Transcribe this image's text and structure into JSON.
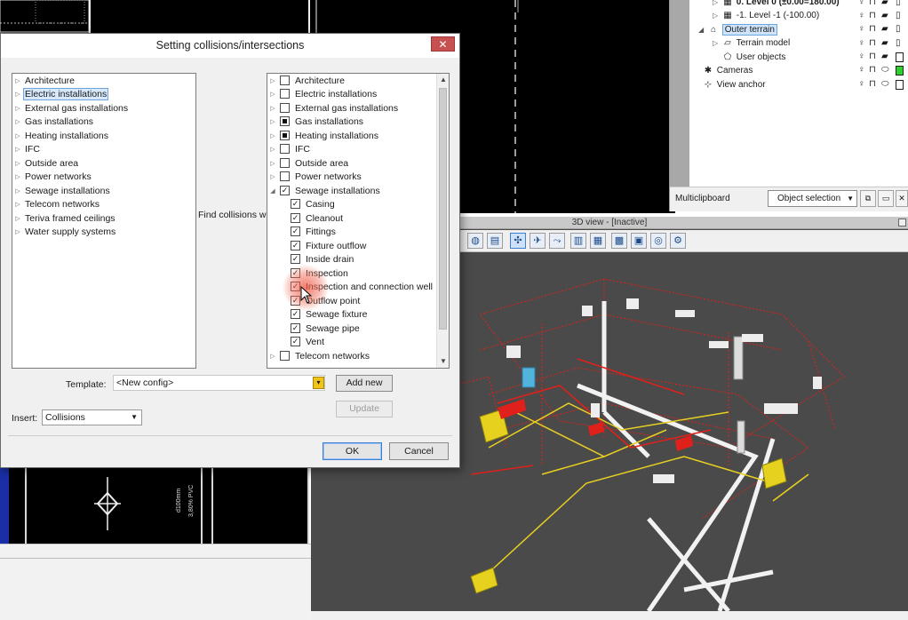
{
  "background": {
    "tree": {
      "items": [
        {
          "label": "0. Level 0 (±0.00=180.00)",
          "icon": "floor-icon",
          "bold": true
        },
        {
          "label": "-1. Level -1 (-100.00)",
          "icon": "floor-icon",
          "bold": false
        },
        {
          "label": "Outer terrain",
          "icon": "terrain-icon",
          "selected": true
        },
        {
          "label": "Terrain model",
          "icon": "terrain-model-icon"
        },
        {
          "label": "User objects",
          "icon": "user-objects-icon"
        },
        {
          "label": "Cameras",
          "icon": "camera-icon"
        },
        {
          "label": "View anchor",
          "icon": "anchor-icon"
        }
      ]
    },
    "multiclipboard_label": "Multiclipboard",
    "object_selection": "Object selection",
    "cad_dimension_text": "d100mm",
    "cad_pipe_text": "3,80% PVC",
    "view3d_title": "3D view - [Inactive]"
  },
  "dialog": {
    "title": "Setting collisions/intersections",
    "close_glyph": "✕",
    "left_list": [
      {
        "label": "Architecture"
      },
      {
        "label": "Electric installations",
        "selected": true
      },
      {
        "label": "External gas installations"
      },
      {
        "label": "Gas installations"
      },
      {
        "label": "Heating installations"
      },
      {
        "label": "IFC"
      },
      {
        "label": "Outside area"
      },
      {
        "label": "Power networks"
      },
      {
        "label": "Sewage installations"
      },
      {
        "label": "Telecom networks"
      },
      {
        "label": "Teriva framed ceilings"
      },
      {
        "label": "Water supply systems"
      }
    ],
    "find_label": "Find collisions with",
    "right_list": [
      {
        "label": "Architecture",
        "check": "none",
        "level": 0,
        "expander": "closed"
      },
      {
        "label": "Electric installations",
        "check": "none",
        "level": 0,
        "expander": "closed"
      },
      {
        "label": "External gas installations",
        "check": "none",
        "level": 0,
        "expander": "closed"
      },
      {
        "label": "Gas installations",
        "check": "partial",
        "level": 0,
        "expander": "closed"
      },
      {
        "label": "Heating installations",
        "check": "partial",
        "level": 0,
        "expander": "closed"
      },
      {
        "label": "IFC",
        "check": "none",
        "level": 0,
        "expander": "closed"
      },
      {
        "label": "Outside area",
        "check": "none",
        "level": 0,
        "expander": "closed"
      },
      {
        "label": "Power networks",
        "check": "none",
        "level": 0,
        "expander": "closed"
      },
      {
        "label": "Sewage installations",
        "check": "checked",
        "level": 0,
        "expander": "open"
      },
      {
        "label": "Casing",
        "check": "checked",
        "level": 1
      },
      {
        "label": "Cleanout",
        "check": "checked",
        "level": 1
      },
      {
        "label": "Fittings",
        "check": "checked",
        "level": 1
      },
      {
        "label": "Fixture outflow",
        "check": "checked",
        "level": 1
      },
      {
        "label": "Inside drain",
        "check": "checked",
        "level": 1
      },
      {
        "label": "Inspection",
        "check": "checked",
        "level": 1
      },
      {
        "label": "Inspection and connection well",
        "check": "checked",
        "level": 1
      },
      {
        "label": "Outflow point",
        "check": "checked",
        "level": 1
      },
      {
        "label": "Sewage fixture",
        "check": "checked",
        "level": 1
      },
      {
        "label": "Sewage pipe",
        "check": "checked",
        "level": 1
      },
      {
        "label": "Vent",
        "check": "checked",
        "level": 1
      },
      {
        "label": "Telecom networks",
        "check": "none",
        "level": 0,
        "expander": "closed"
      }
    ],
    "template_label": "Template:",
    "template_value": "<New config>",
    "add_new_label": "Add new",
    "update_label": "Update",
    "insert_label": "Insert:",
    "insert_value": "Collisions",
    "ok_label": "OK",
    "cancel_label": "Cancel"
  },
  "colors": {
    "pipe_red": "#e0201a",
    "pipe_yellow": "#e8d020",
    "fixture_yellow": "#e6d21e",
    "accent_blue": "#3c7fd9"
  }
}
